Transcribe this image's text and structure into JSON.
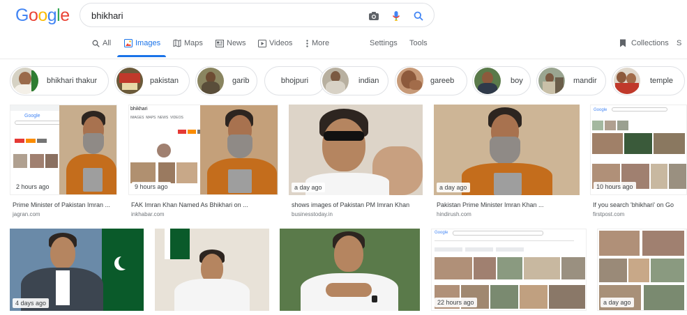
{
  "search": {
    "query": "bhikhari"
  },
  "logo": {
    "text": "Google"
  },
  "tabs": [
    {
      "label": "All",
      "icon": "search-icon"
    },
    {
      "label": "Images",
      "icon": "image-icon"
    },
    {
      "label": "Maps",
      "icon": "map-icon"
    },
    {
      "label": "News",
      "icon": "news-icon"
    },
    {
      "label": "Videos",
      "icon": "video-icon"
    },
    {
      "label": "More",
      "icon": "more-vert-icon"
    },
    {
      "label": "Settings"
    },
    {
      "label": "Tools"
    },
    {
      "label": "Collections",
      "icon": "bookmark-icon"
    },
    {
      "label": "S"
    }
  ],
  "chips": [
    {
      "label": "bhikhari thakur"
    },
    {
      "label": "pakistan"
    },
    {
      "label": "garib"
    },
    {
      "label": "bhojpuri"
    },
    {
      "label": "indian"
    },
    {
      "label": "gareeb"
    },
    {
      "label": "boy"
    },
    {
      "label": "mandir"
    },
    {
      "label": "temple"
    }
  ],
  "results": [
    {
      "time": "2 hours ago",
      "title": "Prime Minister of Pakistan Imran ...",
      "source": "jagran.com"
    },
    {
      "time": "9 hours ago",
      "title": "FAK Imran Khan Named As Bhikhari on ...",
      "source": "inkhabar.com"
    },
    {
      "time": "a day ago",
      "title": "shows images of Pakistan PM Imran Khan",
      "source": "businesstoday.in"
    },
    {
      "time": "a day ago",
      "title": "Pakistan Prime Minister Imran Khan ...",
      "source": "hindirush.com"
    },
    {
      "time": "10 hours ago",
      "title": "If you search 'bhikhari' on Go",
      "source": "firstpost.com"
    },
    {
      "time": "4 days ago"
    },
    {
      "time": ""
    },
    {
      "time": ""
    },
    {
      "time": "22 hours ago"
    },
    {
      "time": "a day ago"
    }
  ],
  "colors": {
    "accent": "#1a73e8",
    "blue": "#4285f4",
    "red": "#ea4335",
    "yellow": "#fbbc05",
    "green": "#34a853"
  }
}
